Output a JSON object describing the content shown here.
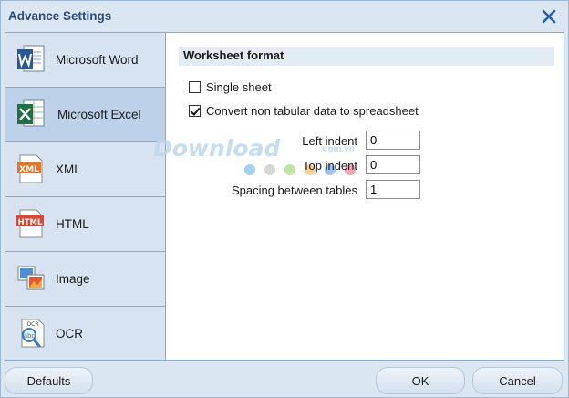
{
  "window": {
    "title": "Advance Settings"
  },
  "sidebar": {
    "items": [
      {
        "label": "Microsoft Word",
        "icon": "word-icon",
        "selected": false
      },
      {
        "label": "Microsoft Excel",
        "icon": "excel-icon",
        "selected": true
      },
      {
        "label": "XML",
        "icon": "xml-icon",
        "selected": false
      },
      {
        "label": "HTML",
        "icon": "html-icon",
        "selected": false
      },
      {
        "label": "Image",
        "icon": "image-icon",
        "selected": false
      },
      {
        "label": "OCR",
        "icon": "ocr-icon",
        "selected": false
      }
    ]
  },
  "worksheet": {
    "section_title": "Worksheet format",
    "single_sheet": {
      "label": "Single sheet",
      "checked": false
    },
    "convert_non_tabular": {
      "label": "Convert non tabular data to spreadsheet",
      "checked": true
    },
    "left_indent": {
      "label": "Left indent",
      "value": "0"
    },
    "top_indent": {
      "label": "Top indent",
      "value": "0"
    },
    "spacing_between_tables": {
      "label": "Spacing between tables",
      "value": "1"
    }
  },
  "watermark": {
    "text": "Download",
    "suffix": ".com.vn"
  },
  "footer": {
    "defaults_label": "Defaults",
    "ok_label": "OK",
    "cancel_label": "Cancel"
  },
  "colors": {
    "title_text": "#2a4d7c",
    "selected_item_bg": "#bdd1e9",
    "close_x": "#2a5fa8"
  }
}
